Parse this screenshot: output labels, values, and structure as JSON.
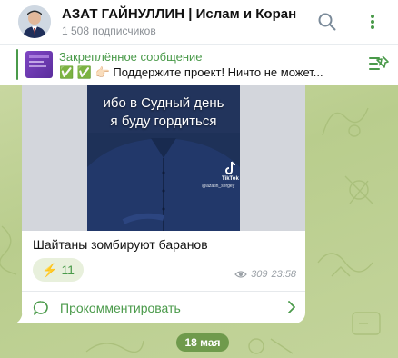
{
  "header": {
    "title": "АЗАТ ГАЙНУЛЛИН | Ислам и Коран",
    "subscribers": "1 508 подписчиков",
    "search_icon": "search-icon",
    "more_icon": "more-dots-icon"
  },
  "pinned": {
    "title": "Закреплённое сообщение",
    "text": "✅ ✅ 👉🏻 Поддержите проект!   Ничто не может...",
    "icon": "pin-list-icon"
  },
  "message": {
    "overlay_line1": "ибо в Судный день",
    "overlay_line2": "я буду гордиться",
    "tiktok_label": "TikTok",
    "tiktok_user": "@azatin_sergey",
    "caption": "Шайтаны зомбируют баранов",
    "reaction_emoji": "⚡",
    "reaction_count": "11",
    "views": "309",
    "time": "23:58",
    "comment_label": "Прокомментировать"
  },
  "date_separator": "18 мая",
  "colors": {
    "accent": "#4a9a4a",
    "date_pill": "#6f9a4c",
    "chat_background": "#c5d49a"
  }
}
